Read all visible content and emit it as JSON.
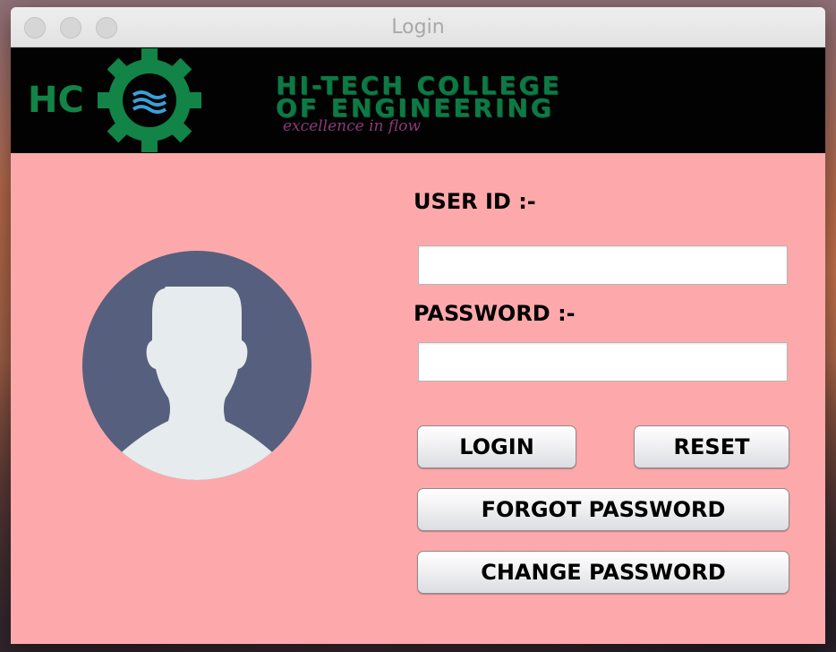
{
  "window": {
    "title": "Login"
  },
  "banner": {
    "logo_initials": "HC",
    "logo_ring_text": "HI-TECH COLLEGE OF ENGINEERING",
    "college_name_line1": "HI-TECH COLLEGE",
    "college_name_line2": "OF ENGINEERING",
    "tagline": "excellence in flow"
  },
  "form": {
    "user_id_label": "USER ID :-",
    "user_id_value": "",
    "password_label": "PASSWORD :-",
    "password_value": ""
  },
  "buttons": {
    "login": "LOGIN",
    "reset": "RESET",
    "forgot_password": "FORGOT PASSWORD",
    "change_password": "CHANGE PASSWORD"
  },
  "colors": {
    "form_background": "#fda9ab",
    "banner_background": "#020202",
    "banner_text": "#0d7a45",
    "tagline_text": "#8a3a7a",
    "avatar_circle": "#56607e",
    "avatar_silhouette": "#e6ebed"
  },
  "icons": {
    "avatar": "user-avatar-icon",
    "logo": "college-gear-logo"
  }
}
